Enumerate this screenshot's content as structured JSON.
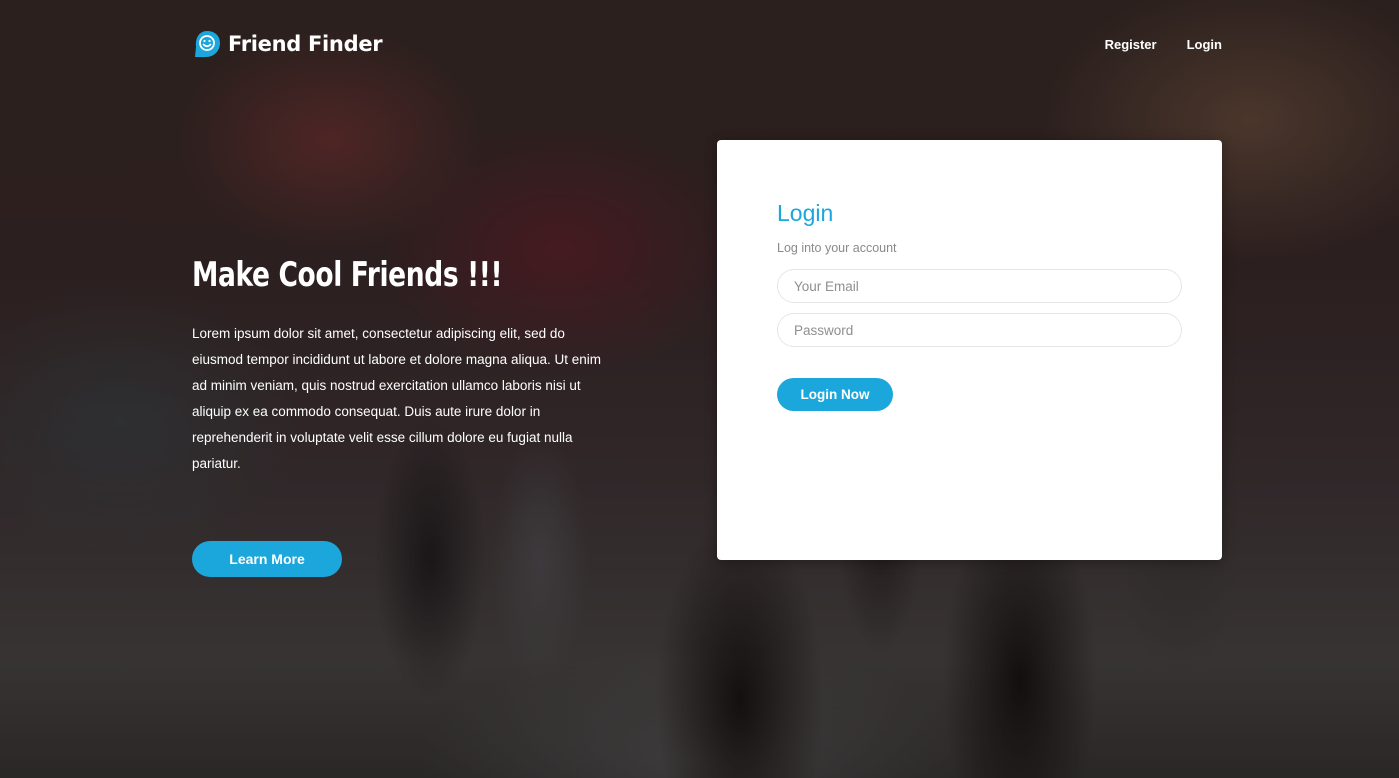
{
  "brand": {
    "name": "Friend Finder",
    "icon": "smiley-bubble-icon",
    "accent_color": "#1ba7dc"
  },
  "nav": {
    "register": "Register",
    "login": "Login"
  },
  "hero": {
    "title": "Make Cool Friends !!!",
    "text": "Lorem ipsum dolor sit amet, consectetur adipiscing elit, sed do eiusmod tempor incididunt ut labore et dolore magna aliqua. Ut enim ad minim veniam, quis nostrud exercitation ullamco laboris nisi ut aliquip ex ea commodo consequat. Duis aute irure dolor in reprehenderit in voluptate velit esse cillum dolore eu fugiat nulla pariatur.",
    "button": "Learn More"
  },
  "login": {
    "title": "Login",
    "subtitle": "Log into your account",
    "email_placeholder": "Your Email",
    "password_placeholder": "Password",
    "button": "Login Now"
  }
}
